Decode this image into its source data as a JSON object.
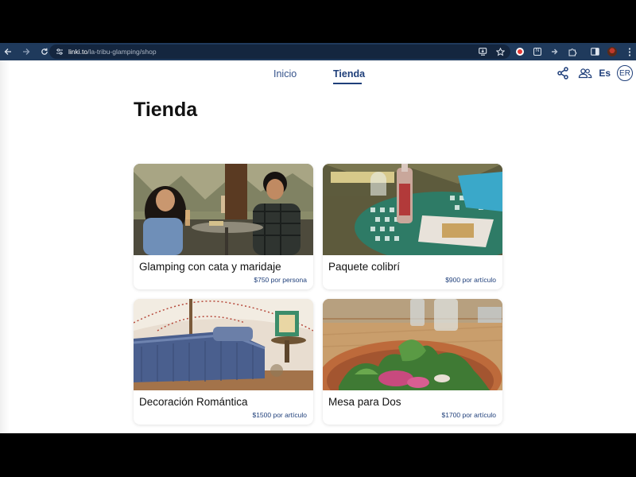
{
  "browser": {
    "url_host": "linki.to",
    "url_path": "/la-tribu-glamping/shop",
    "icons": {
      "back": "arrow-left-icon",
      "forward": "arrow-right-icon",
      "reload": "reload-icon",
      "site_info": "tune-icon",
      "install": "install-app-icon",
      "bookmark": "star-icon",
      "extensions": "puzzle-icon",
      "side_panel": "side-panel-icon",
      "menu": "kebab-menu-icon"
    }
  },
  "nav": {
    "links": [
      {
        "label": "Inicio"
      },
      {
        "label": "Tienda"
      }
    ],
    "language": "Es",
    "avatar_initials": "ER"
  },
  "page": {
    "heading": "Tienda"
  },
  "products": [
    {
      "title": "Glamping con cata y maridaje",
      "price": "$750 por persona"
    },
    {
      "title": "Paquete colibrí",
      "price": "$900 por artículo"
    },
    {
      "title": "Decoración Romántica",
      "price": "$1500 por artículo"
    },
    {
      "title": "Mesa para Dos",
      "price": "$1700 por artículo"
    }
  ],
  "colors": {
    "toolbar": "#1f3a5c",
    "accent": "#1f3f7a",
    "nav_link": "#34528a"
  }
}
